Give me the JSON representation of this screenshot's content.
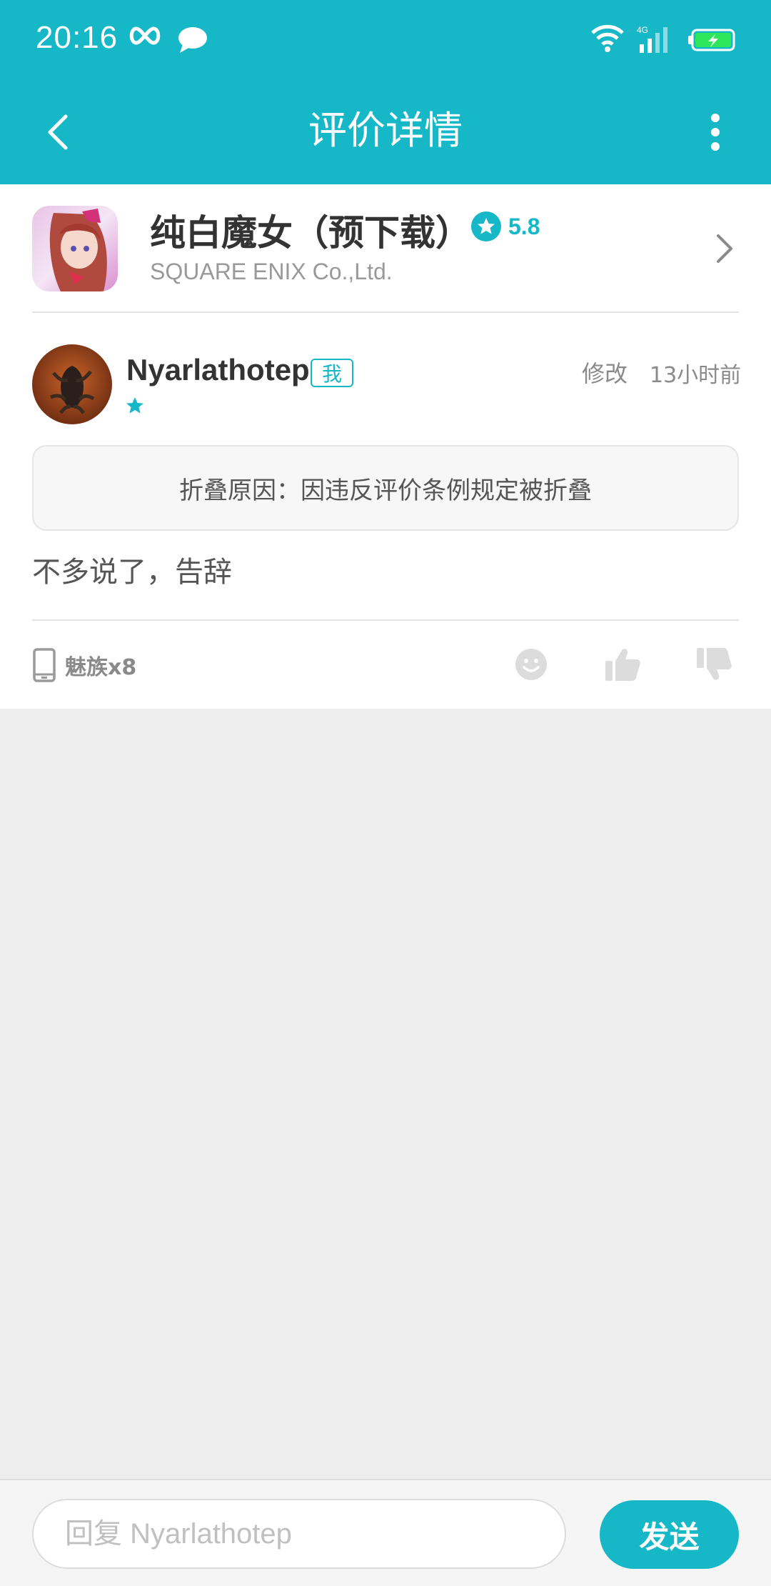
{
  "status_bar": {
    "time": "20:16",
    "icons": [
      "infinity-icon",
      "chat-bubble-icon",
      "wifi-icon",
      "signal-4g-icon",
      "battery-charging-icon"
    ],
    "network_label": "4G"
  },
  "nav": {
    "title": "评价详情",
    "back_icon": "chevron-left-icon",
    "more_icon": "more-vertical-icon"
  },
  "app": {
    "name": "纯白魔女（预下载）",
    "rating": "5.8",
    "developer": "SQUARE ENIX Co.,Ltd."
  },
  "review": {
    "username": "Nyarlathotep",
    "me_tag": "我",
    "edit_label": "修改",
    "time_ago": "13小时前",
    "stars": 1,
    "fold_notice": "折叠原因：因违反评价条例规定被折叠",
    "text": "不多说了，告辞",
    "device": "魅族x8"
  },
  "reply": {
    "placeholder": "回复 Nyarlathotep",
    "send_label": "发送"
  },
  "colors": {
    "accent": "#16b8c8",
    "background": "#ededed",
    "muted_text": "#8a8a8a"
  }
}
